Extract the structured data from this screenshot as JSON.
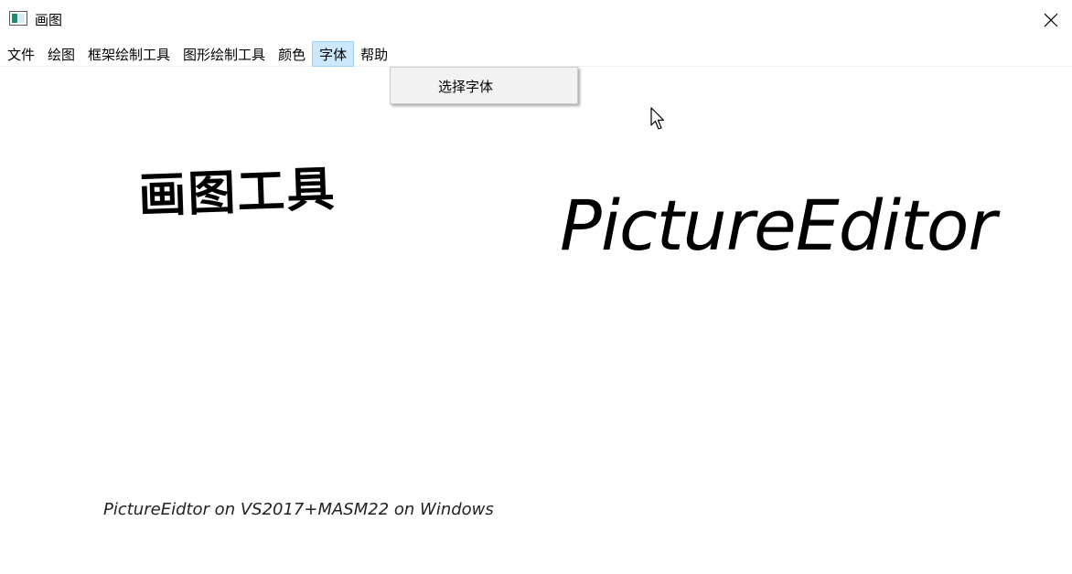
{
  "window": {
    "title": "画图"
  },
  "menubar": {
    "items": [
      {
        "label": "文件"
      },
      {
        "label": "绘图"
      },
      {
        "label": "框架绘制工具"
      },
      {
        "label": "图形绘制工具"
      },
      {
        "label": "颜色"
      },
      {
        "label": "字体",
        "active": true
      },
      {
        "label": "帮助"
      }
    ]
  },
  "dropdown": {
    "items": [
      {
        "label": "选择字体"
      }
    ]
  },
  "canvas": {
    "cn_title": "画图工具",
    "en_title": "PictureEditor",
    "footer": "PictureEidtor on VS2017+MASM22 on Windows"
  },
  "colors": {
    "menu_active_bg": "#cce8ff",
    "menu_active_border": "#99d1ff",
    "dropdown_bg": "#f2f2f2"
  }
}
